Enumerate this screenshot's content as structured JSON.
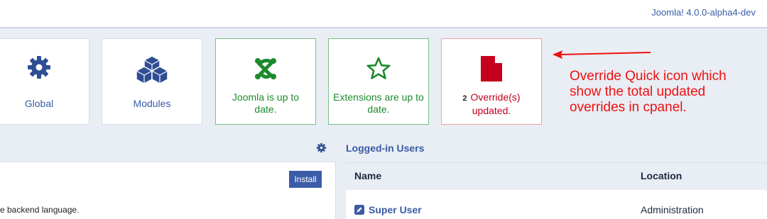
{
  "header": {
    "version": "Joomla! 4.0.0-alpha4-dev"
  },
  "quickicons": {
    "global": {
      "label": "Global",
      "icon": "gear-icon"
    },
    "modules": {
      "label": "Modules",
      "icon": "cubes-icon"
    },
    "joomla": {
      "label": "Joomla is up to date.",
      "icon": "joomla-logo-icon"
    },
    "extensions": {
      "label": "Extensions are up to date.",
      "icon": "star-icon"
    },
    "overrides": {
      "count": "2",
      "label": "Override(s) updated.",
      "icon": "file-icon"
    }
  },
  "annotation": {
    "text": "Override Quick icon which show the total updated overrides in cpanel."
  },
  "panel_left": {
    "install_label": "Install",
    "text": "e backend language."
  },
  "logged_in": {
    "title": "Logged-in Users",
    "columns": [
      "Name",
      "Location"
    ],
    "rows": [
      {
        "name": "Super User",
        "location": "Administration"
      }
    ]
  },
  "colors": {
    "accent": "#3a5ba3",
    "success": "#1c8a2c",
    "danger": "#c4001e",
    "annotation": "#ef1010"
  }
}
